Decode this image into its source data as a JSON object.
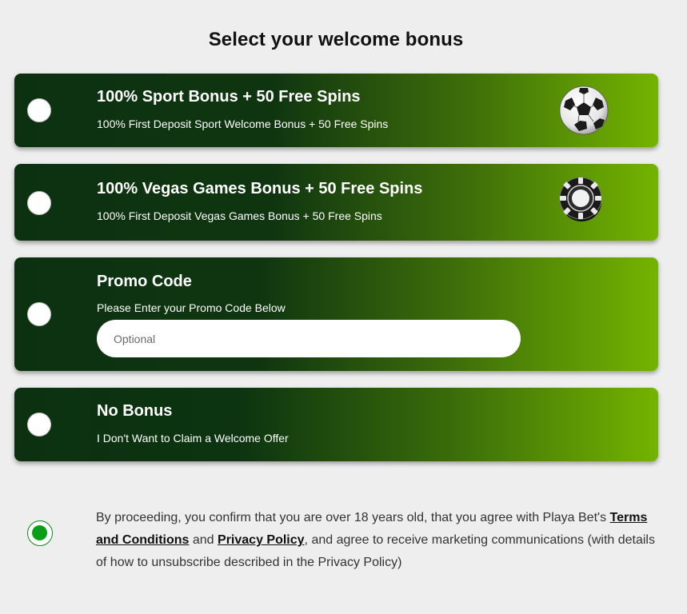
{
  "heading": "Select your welcome bonus",
  "bonus_options": [
    {
      "title": "100% Sport Bonus + 50 Free Spins",
      "subtitle": "100% First Deposit Sport Welcome Bonus + 50 Free Spins",
      "icon": "soccer-ball-icon",
      "selected": false
    },
    {
      "title": "100% Vegas Games Bonus + 50 Free Spins",
      "subtitle": "100% First Deposit Vegas Games Bonus + 50 Free Spins",
      "icon": "poker-chip-icon",
      "selected": false
    },
    {
      "title": "Promo Code",
      "subtitle": "Please Enter your Promo Code Below",
      "input_placeholder": "Optional",
      "input_value": "",
      "selected": false
    },
    {
      "title": "No Bonus",
      "subtitle": "I Don't Want to Claim a Welcome Offer",
      "selected": false
    }
  ],
  "consent": {
    "checked": true,
    "text_before": "By proceeding, you confirm that you are over 18 years old, that you agree with Playa Bet's ",
    "terms_link": "Terms and Conditions",
    "text_middle": " and ",
    "privacy_link": "Privacy Policy",
    "text_after": ", and agree to receive marketing communications (with details of how to unsubscribe described in the Privacy Policy)"
  },
  "colors": {
    "card_dark": "#0b3111",
    "card_light": "#74b400",
    "consent_radio": "#0b9e17",
    "background": "#eeeeee"
  }
}
